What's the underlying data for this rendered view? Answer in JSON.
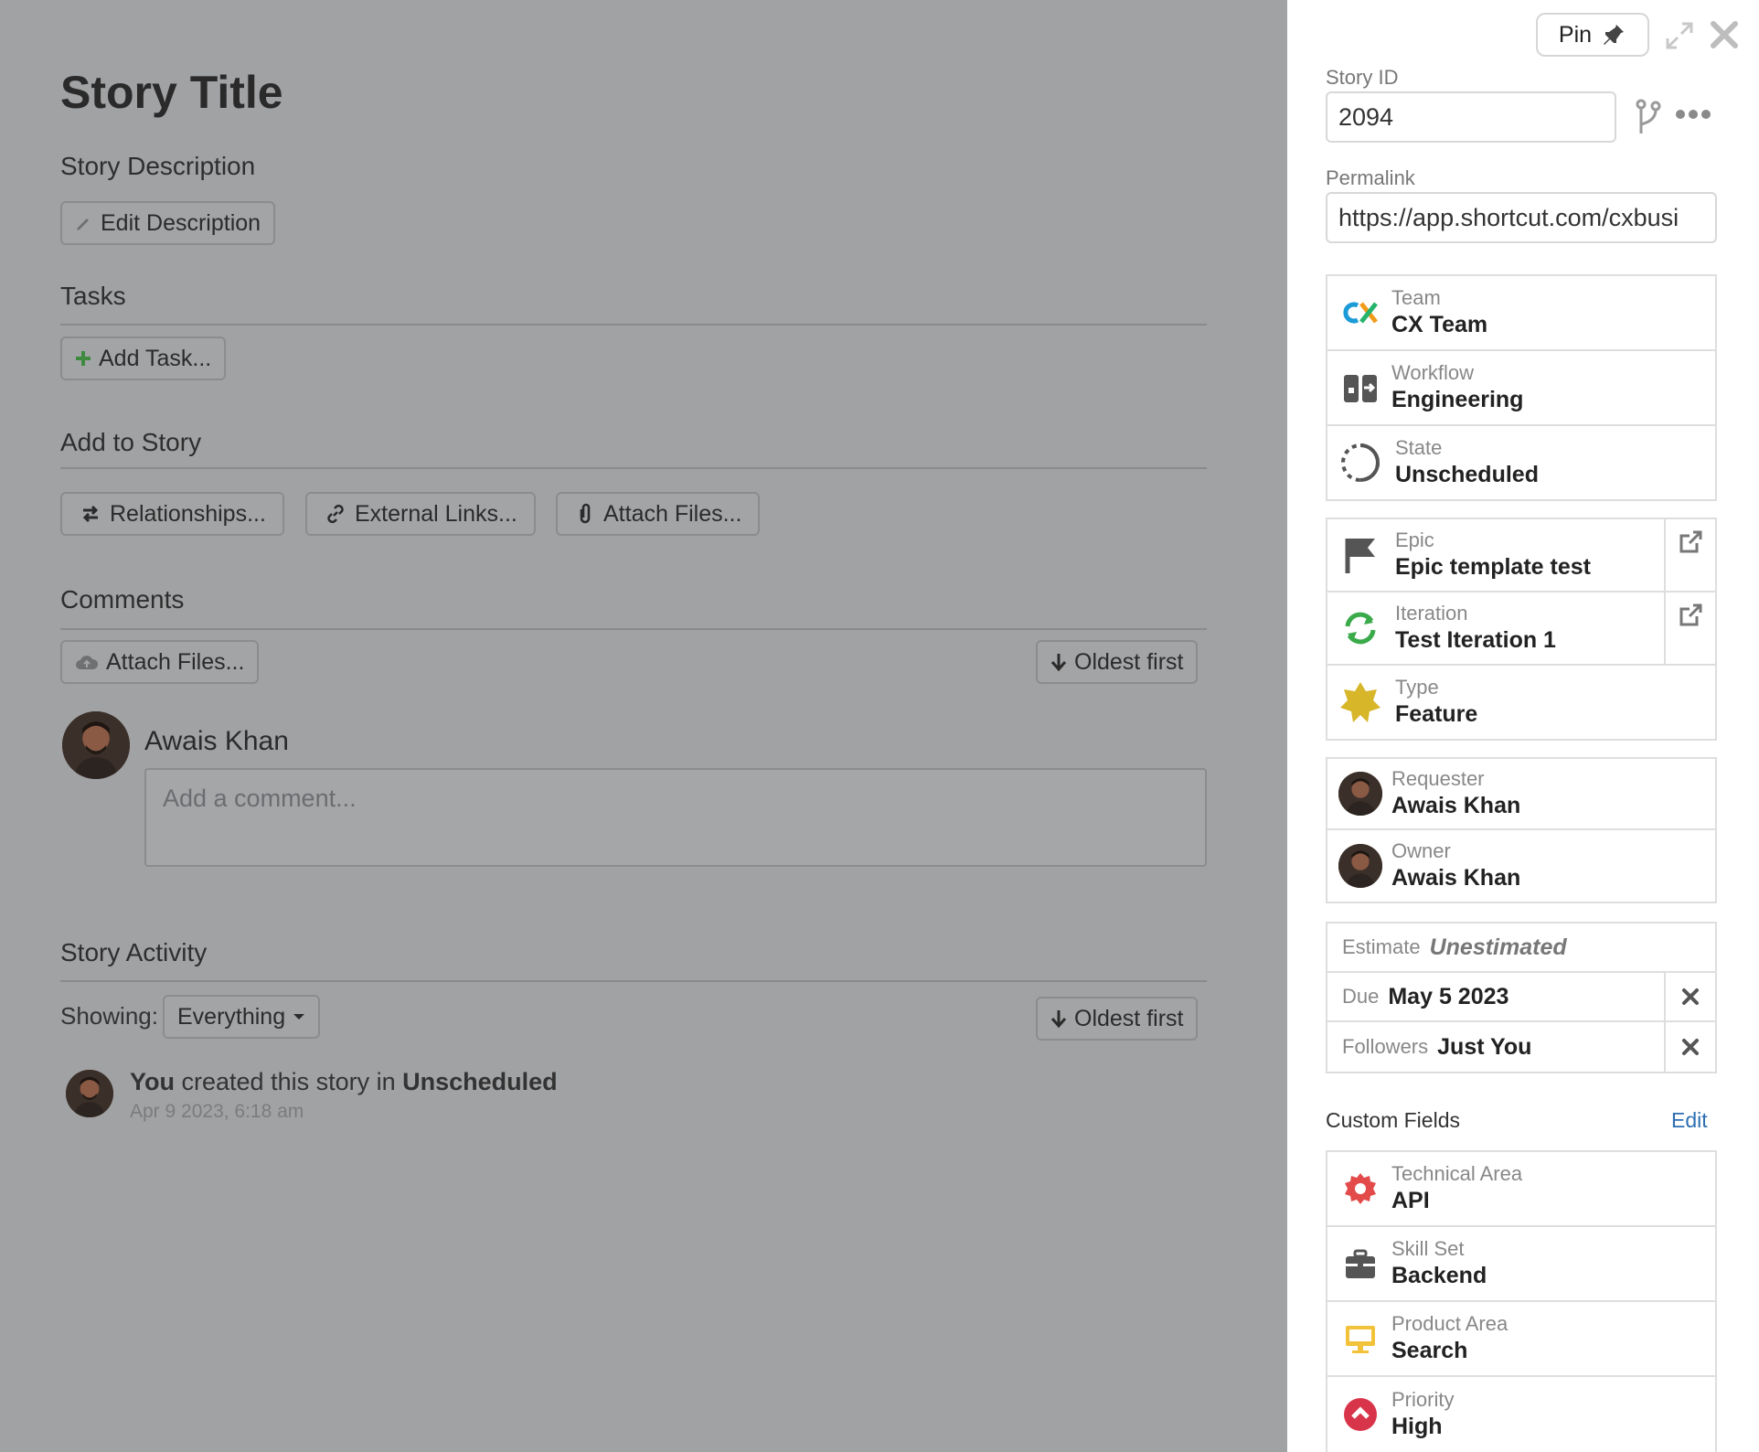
{
  "main": {
    "title": "Story Title",
    "description_heading": "Story Description",
    "edit_description_label": "Edit Description",
    "tasks_heading": "Tasks",
    "add_task_label": "Add Task...",
    "add_to_story_heading": "Add to Story",
    "relationships_label": "Relationships...",
    "external_links_label": "External Links...",
    "attach_files_label": "Attach Files...",
    "comments_heading": "Comments",
    "comments_attach_label": "Attach Files...",
    "comments_sort_label": "Oldest first",
    "comment_author": "Awais Khan",
    "comment_placeholder": "Add a comment...",
    "activity_heading": "Story Activity",
    "showing_label": "Showing:",
    "showing_value": "Everything",
    "activity_sort_label": "Oldest first",
    "activity_item": {
      "actor": "You",
      "action": "created this story in",
      "state": "Unscheduled",
      "timestamp": "Apr 9 2023, 6:18 am"
    }
  },
  "sidebar": {
    "pin_label": "Pin",
    "story_id_label": "Story ID",
    "story_id_value": "2094",
    "permalink_label": "Permalink",
    "permalink_value": "https://app.shortcut.com/cxbusi",
    "team": {
      "label": "Team",
      "value": "CX Team"
    },
    "workflow": {
      "label": "Workflow",
      "value": "Engineering"
    },
    "state": {
      "label": "State",
      "value": "Unscheduled"
    },
    "epic": {
      "label": "Epic",
      "value": "Epic template test"
    },
    "iteration": {
      "label": "Iteration",
      "value": "Test Iteration 1"
    },
    "type": {
      "label": "Type",
      "value": "Feature"
    },
    "requester": {
      "label": "Requester",
      "value": "Awais Khan"
    },
    "owner": {
      "label": "Owner",
      "value": "Awais Khan"
    },
    "estimate": {
      "label": "Estimate",
      "value": "Unestimated"
    },
    "due": {
      "label": "Due",
      "value": "May 5 2023"
    },
    "followers": {
      "label": "Followers",
      "value": "Just You"
    },
    "custom_fields_heading": "Custom Fields",
    "custom_fields_edit": "Edit",
    "custom_fields": [
      {
        "label": "Technical Area",
        "value": "API"
      },
      {
        "label": "Skill Set",
        "value": "Backend"
      },
      {
        "label": "Product Area",
        "value": "Search"
      },
      {
        "label": "Priority",
        "value": "High"
      }
    ]
  },
  "colors": {
    "overlay_bg": "#a1a2a4",
    "sidebar_bg": "#ffffff",
    "link_blue": "#2d6fb3",
    "iteration_green": "#3aaa4a",
    "type_yellow": "#d7b62a",
    "tech_red": "#e34b4b",
    "product_yellow": "#f2c33a",
    "priority_red": "#d8354a"
  }
}
